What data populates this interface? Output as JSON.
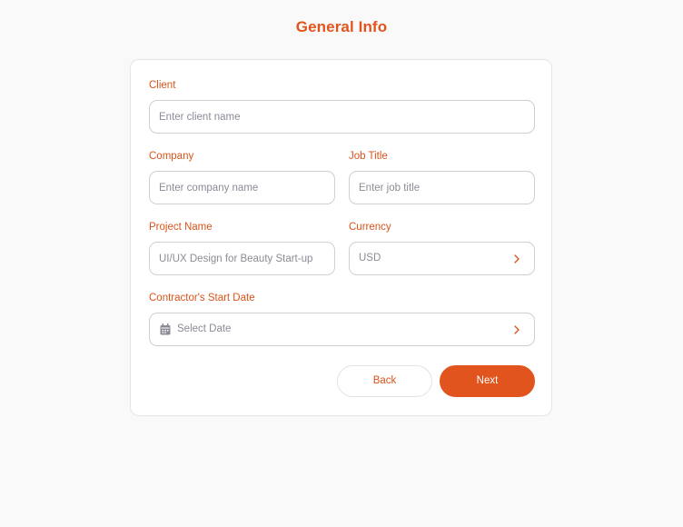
{
  "header": {
    "title": "General Info"
  },
  "form": {
    "client": {
      "label": "Client",
      "placeholder": "Enter client name"
    },
    "company": {
      "label": "Company",
      "placeholder": "Enter company name"
    },
    "job_title": {
      "label": "Job Title",
      "placeholder": "Enter job title"
    },
    "project_name": {
      "label": "Project Name",
      "placeholder": "UI/UX Design for Beauty Start-up"
    },
    "currency": {
      "label": "Currency",
      "value": "USD",
      "icon": "chevron-right-icon"
    },
    "start_date": {
      "label": "Contractor's Start Date",
      "placeholder": "Select Date",
      "icon": "calendar-icon",
      "chevron": "chevron-right-icon"
    }
  },
  "actions": {
    "back_label": "Back",
    "next_label": "Next"
  },
  "colors": {
    "accent": "#e2541e",
    "label": "#d9531c",
    "placeholder": "#8b8b96",
    "border": "#cfcfd4",
    "background": "#f9f9f9"
  }
}
